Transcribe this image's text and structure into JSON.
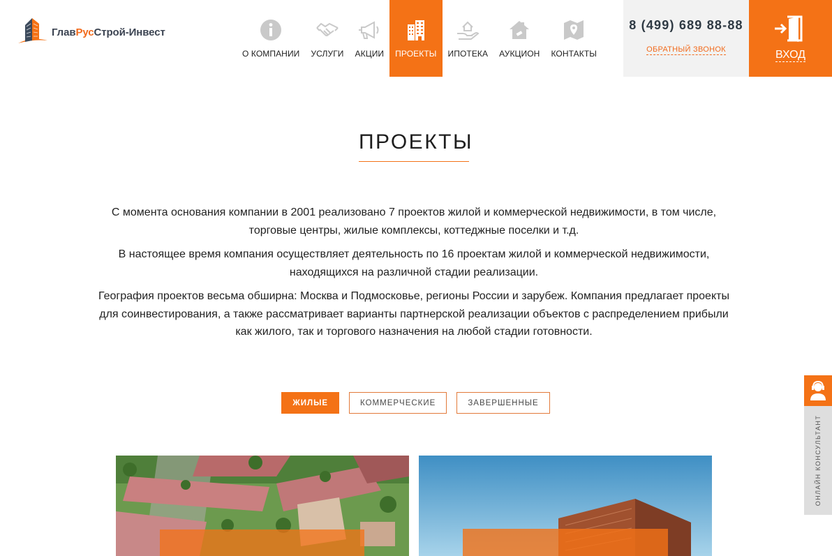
{
  "brand": {
    "name_part1": "Глав",
    "name_part2": "Рус",
    "name_part3": "Строй-Инвест",
    "accent_color": "#f47216"
  },
  "nav": {
    "items": [
      {
        "label": "О компании",
        "icon": "info-icon",
        "active": false
      },
      {
        "label": "Услуги",
        "icon": "handshake-icon",
        "active": false
      },
      {
        "label": "Акции",
        "icon": "megaphone-icon",
        "active": false
      },
      {
        "label": "Проекты",
        "icon": "buildings-icon",
        "active": true
      },
      {
        "label": "Ипотека",
        "icon": "hand-house-icon",
        "active": false
      },
      {
        "label": "Аукцион",
        "icon": "gavel-house-icon",
        "active": false
      },
      {
        "label": "Контакты",
        "icon": "map-pin-icon",
        "active": false
      }
    ]
  },
  "contact": {
    "phone": "8 (499) 689 88-88",
    "callback_label": "Обратный звонок"
  },
  "login": {
    "label": "Вход",
    "icon": "door-enter-icon"
  },
  "page": {
    "title": "ПРОЕКТЫ",
    "paragraphs": [
      "С момента основания компании в 2001 реализовано 7 проектов жилой и коммерческой недвижимости, в том числе, торговые центры, жилые комплексы, коттеджные поселки и т.д.",
      "В настоящее время компания осуществляет деятельность по 16 проектам жилой и коммерческой недвижимости, находящихся на различной стадии реализации.",
      "География проектов весьма обширна: Москва и Подмосковье, регионы России и зарубеж. Компания предлагает проекты для соинвестирования, а также рассматривает варианты партнерской реализации объектов с распределением прибыли как жилого, так и торгового назначения на любой стадии готовности."
    ]
  },
  "filters": {
    "items": [
      {
        "label": "Жилые",
        "active": true
      },
      {
        "label": "Коммерческие",
        "active": false
      },
      {
        "label": "Завершенные",
        "active": false
      }
    ]
  },
  "projects": {
    "cards": [
      {
        "image": "aerial-residential-complex"
      },
      {
        "image": "brick-tower-sky"
      }
    ]
  },
  "consultant": {
    "label": "Онлайн консультант",
    "icon": "operator-icon"
  }
}
